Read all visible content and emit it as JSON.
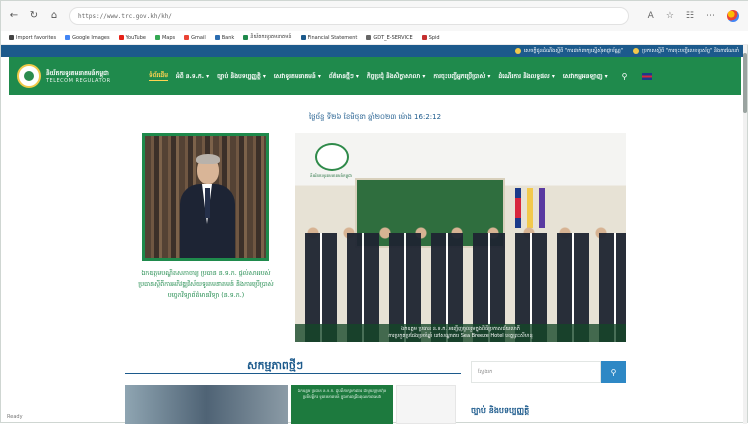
{
  "browser": {
    "url": "https://www.trc.gov.kh/kh/",
    "bookmarks": [
      {
        "label": "Import favorites",
        "color": "#444444"
      },
      {
        "label": "Google Images",
        "color": "#4285f4"
      },
      {
        "label": "YouTube",
        "color": "#e62117"
      },
      {
        "label": "Maps",
        "color": "#34a853"
      },
      {
        "label": "Gmail",
        "color": "#ea4335"
      },
      {
        "label": "Bank",
        "color": "#2b6cb0"
      },
      {
        "label": "និយ័តករទូរគមនាគមន៍",
        "color": "#1f8a4c"
      },
      {
        "label": "Financial Statement",
        "color": "#1c5a8c"
      },
      {
        "label": "GDT_E-SERVICE",
        "color": "#666666"
      },
      {
        "label": "Spid",
        "color": "#c53030"
      }
    ]
  },
  "marquee": {
    "item1": "សេចក្តីជូនដំណឹងស្តីពី \"ការដាក់ពាក្យស្នើសុំអាជ្ញាប័ណ្ណ\"",
    "item2": "ប្រកាសស្តីពី \"ការចុះបញ្ជីលេខទូរស័ព្ទ\" និងការណែនាំ"
  },
  "org": {
    "name_kh": "និយ័តករទូរគមនាគមន៍កម្ពុជា",
    "name_en": "TELECOM REGULATOR"
  },
  "menu": [
    "ទំព័រដើម",
    "អំពី ន.ទ.ក. ▾",
    "ច្បាប់ និងបទប្បញ្ញត្តិ ▾",
    "សេវាទូរគមនាគមន៍ ▾",
    "ព័ត៌មានថ្មីៗ ▾",
    "កិច្ចប្រជុំ និងសិក្ខាសាលា ▾",
    "ការចុះបញ្ជីអ្នកប្រើប្រាស់ ▾",
    "ដំណើរការ និងលទ្ធផល ▾",
    "សេវាកម្មអនឡាញ ▾"
  ],
  "date": "ថ្ងៃច័ន្ទ ទី២៦ ខែមិថុនា ឆ្នាំ២០២៣ ម៉ោង 16:2:12",
  "portrait_caption": "ឯកឧត្តមបណ្ឌិតសភាចារ្យ ប្រធាន ន.ទ.ក. ផ្តល់សាររបស់ប្រធានស្តីពីការអភិវឌ្ឍវិស័យទូរគមនាគមន៍ និងការប្រើប្រាស់បច្ចេកវិទ្យាព័ត៌មានវិទ្យា (ន.ទ.ក.)",
  "event": {
    "logo_text": "និយ័តករទូរគមនាគមន៍កម្ពុជា",
    "caption_line1": "ឯកឧត្តម ប្រធាន ន.ទ.ក. អញ្ជើញចូលរួមក្នុងពិធីប្រកាសជ័យលាភី",
    "caption_line2": "ការប្រកួតប្រជែងប្រចាំឆ្នាំ នៅសណ្ឋាគារ Sea Breeze Hotel ខេត្តព្រះសីហនុ"
  },
  "section": {
    "news_title": "សកម្មភាពថ្មីៗ",
    "search_placeholder": "ស្វែងរក",
    "law_title": "ច្បាប់ និងបទប្បញ្ញត្តិ",
    "thumb2_text": "ឯកឧត្តម ប្រធាន ន.ទ.ក. ជួបពិភាក្សាការងារ ជាមួយក្រុមហ៊ុនប្រតិបត្តិករ ទូរគមនាគមន៍ ក្នុងការពង្រឹងគុណភាពសេវា"
  },
  "status_bar": "Ready",
  "colors": {
    "brand_green": "#1f8a4c",
    "brand_blue": "#1c5a8c",
    "accent_gold": "#ffd451"
  }
}
